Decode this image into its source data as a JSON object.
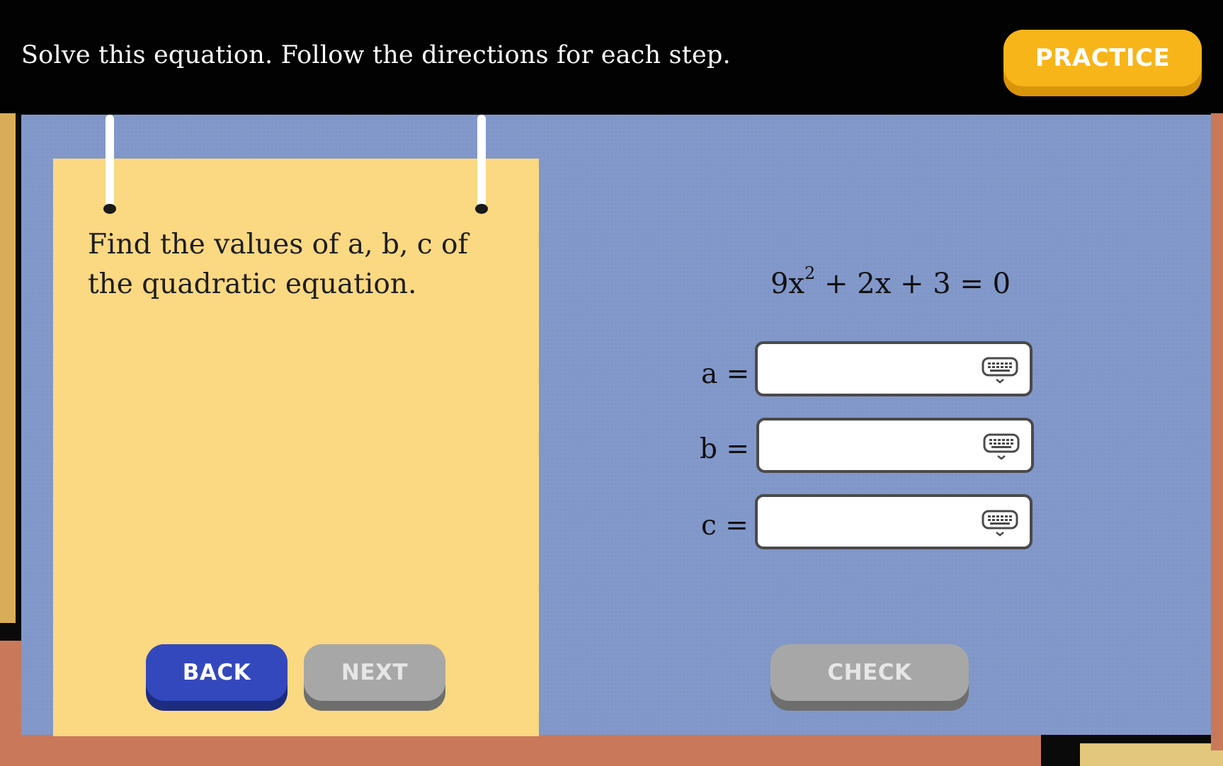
{
  "header": {
    "instruction": "Solve this equation. Follow the directions for each step.",
    "practice_label": "PRACTICE"
  },
  "card": {
    "prompt": "Find the values of a, b, c of the quadratic equation."
  },
  "equation": {
    "coef_a": "9x",
    "exponent": "2",
    "rest": " + 2x + 3 = 0"
  },
  "fields": [
    {
      "label": "a =",
      "value": "",
      "placeholder": "",
      "icon": "keyboard-icon"
    },
    {
      "label": "b =",
      "value": "",
      "placeholder": "",
      "icon": "keyboard-icon"
    },
    {
      "label": "c =",
      "value": "",
      "placeholder": "",
      "icon": "keyboard-icon"
    }
  ],
  "buttons": {
    "back_label": "BACK",
    "next_label": "NEXT",
    "check_label": "CHECK"
  },
  "colors": {
    "practice": "#f7b51a",
    "back": "#3448bd",
    "disabled": "#a7a7a7",
    "board": "#8197c9",
    "card": "#fbd882"
  }
}
